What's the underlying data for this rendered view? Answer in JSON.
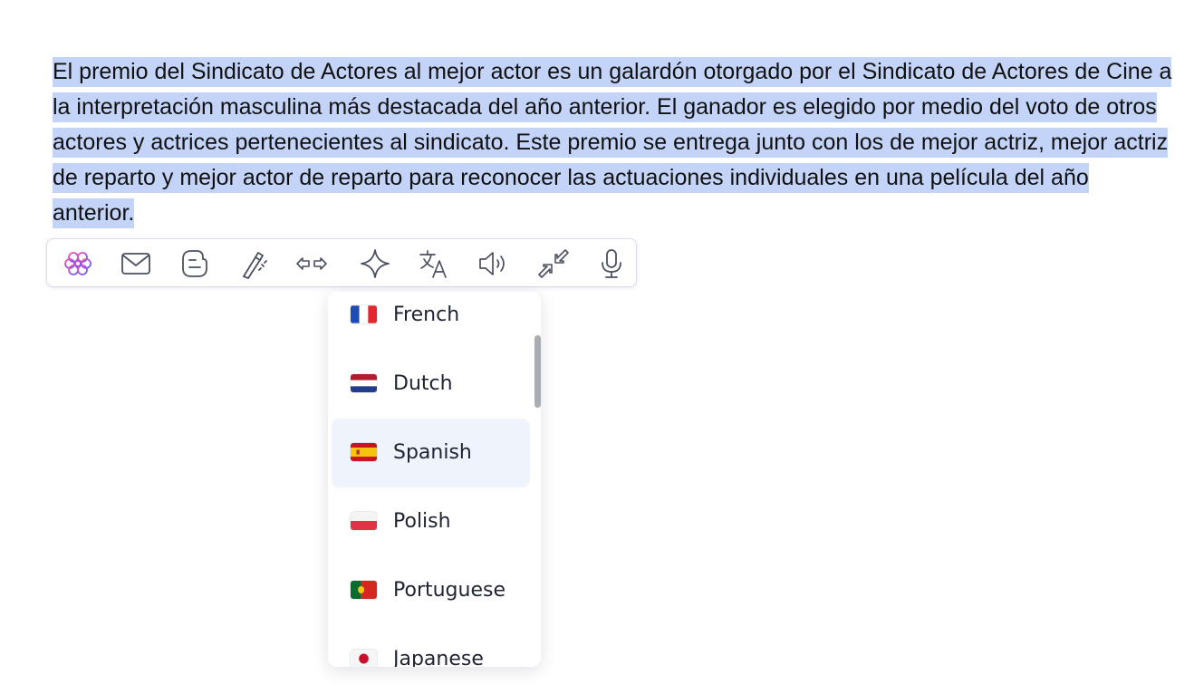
{
  "selected_text": "El premio del Sindicato de Actores al mejor actor es un galardón otorgado por el Sindicato de Actores de Cine a la interpretación masculina más destacada del año anterior. El ganador es elegido por medio del voto de otros actores y actrices pertenecientes al sindicato. Este premio se entrega junto con los de mejor actriz, mejor actriz de reparto y mejor actor de reparto para reconocer las actuaciones individuales en una película del año anterior.",
  "toolbar": {
    "tools": [
      "ai-brain-icon",
      "mail-icon",
      "blogger-icon",
      "magic-wand-icon",
      "arrows-left-right-icon",
      "sparkle-icon",
      "translate-icon",
      "speaker-icon",
      "minimize-arrows-icon",
      "microphone-icon"
    ]
  },
  "language_dropdown": {
    "selected": "Spanish",
    "options": [
      {
        "label": "French",
        "flag": "fr"
      },
      {
        "label": "Dutch",
        "flag": "nl"
      },
      {
        "label": "Spanish",
        "flag": "es"
      },
      {
        "label": "Polish",
        "flag": "pl"
      },
      {
        "label": "Portuguese",
        "flag": "pt"
      },
      {
        "label": "Japanese",
        "flag": "jp"
      }
    ]
  },
  "colors": {
    "selection": "#c3d4f8",
    "active_item": "#eff3fb",
    "icon_stroke": "#4b5060"
  }
}
